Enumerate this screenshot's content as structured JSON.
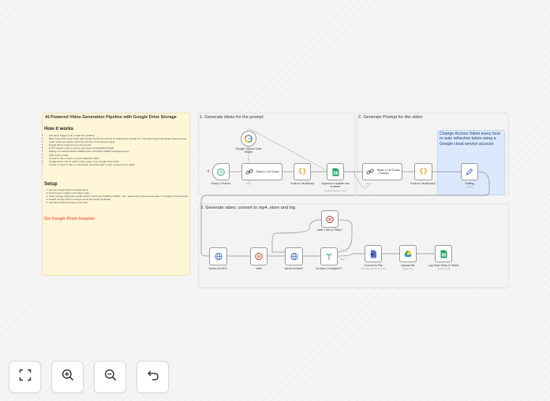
{
  "workflow": {
    "description_note": {
      "title": "AI-Powered Video Generation Pipeline with Google Drive Storage",
      "how_heading": "How it works",
      "how_items": [
        "Schedule Trigger node to start the workflow",
        "Basic LLM chain node works with Google Gemini AI Chat (to be replaced by Claude AI or OpenAI) to generate ideas using a prompt",
        "Code nodes are used to pass the prompt in a structured output",
        "Google Sheet nodes to log in the results",
        "HTTP request node in used to call vertex AI ACCESS TOKEN",
        "Setting is to add ACCESS TOKEN (Note: ACCESS TOKEN Changes hourly)",
        "Wait node to delay",
        "Convert to file is used to convert base64 to MP4",
        "Google Drive node is used to store video in the Google Drive folder",
        "If node to check if video is completed, otherwise wait 1 more minute and run again"
      ],
      "setup_heading": "Setup",
      "setup_items": [
        "Get the Google Sheet template below",
        "Set Prompts in Basic LLM chain nodes",
        "Setup Google Cloud and enable Vertex AI and get ACCESS TOKEN - use \"gcloud auth print-access-token\" in Google Cloud terminal",
        "Enable Google Drive in Google Cloud and setup credential",
        "Get Gemini API and setup credential"
      ],
      "template_link": "Get Google Sheet template"
    },
    "sections": {
      "s1": "1. Generate ideas for the prompt",
      "s2": "2. Generate Prompt for the video",
      "s3": "3. Generate video, convert to mp4, store and log",
      "token_note": "Change Access Token every hour or auto refreshes token using a Google cloud service account"
    },
    "nodes": {
      "gemini": {
        "label": "Google Gemini Chat Model"
      },
      "model_port": {
        "label": "Model"
      },
      "trigger": {
        "label": "Every 2 Hours1"
      },
      "llm1": {
        "label": "Basic LLM Chain"
      },
      "code1": {
        "label": "Code in JavaScript"
      },
      "sheet1": {
        "label": "Append or update row in sheet",
        "sub": "appendOrUpdate: sheet"
      },
      "llm2": {
        "label": "Basic LLM Chain - Prompt"
      },
      "code2": {
        "label": "Code in JavaScript1"
      },
      "setting": {
        "label": "Setting",
        "sub": "manual"
      },
      "veo": {
        "label": "Vertex AI-VEO"
      },
      "wait": {
        "label": "Wait"
      },
      "fetch": {
        "label": "Vertex AI-fetch"
      },
      "wait1": {
        "label": "Wait 1 Min & Retry?"
      },
      "ifnode": {
        "label": "Is Video Complete??",
        "true": "true",
        "false": "false"
      },
      "convert": {
        "label": "Convert to File",
        "sub": "Move Base64 String to File"
      },
      "upload": {
        "label": "Upload file",
        "sub": "upload: file"
      },
      "log": {
        "label": "Log Final Video in Sheet",
        "sub": "update: sheet"
      }
    },
    "ports": {
      "model": "Model",
      "dot": "•"
    }
  },
  "controls": {
    "fit": "fit-view",
    "zoom_in": "zoom-in",
    "zoom_out": "zoom-out",
    "reset": "reset-zoom"
  },
  "colors": {
    "accent": "#f26d4d",
    "sticky_yellow": "#fff6d8",
    "sticky_blue": "#dce8fb",
    "node_border": "#9a9a9a"
  }
}
